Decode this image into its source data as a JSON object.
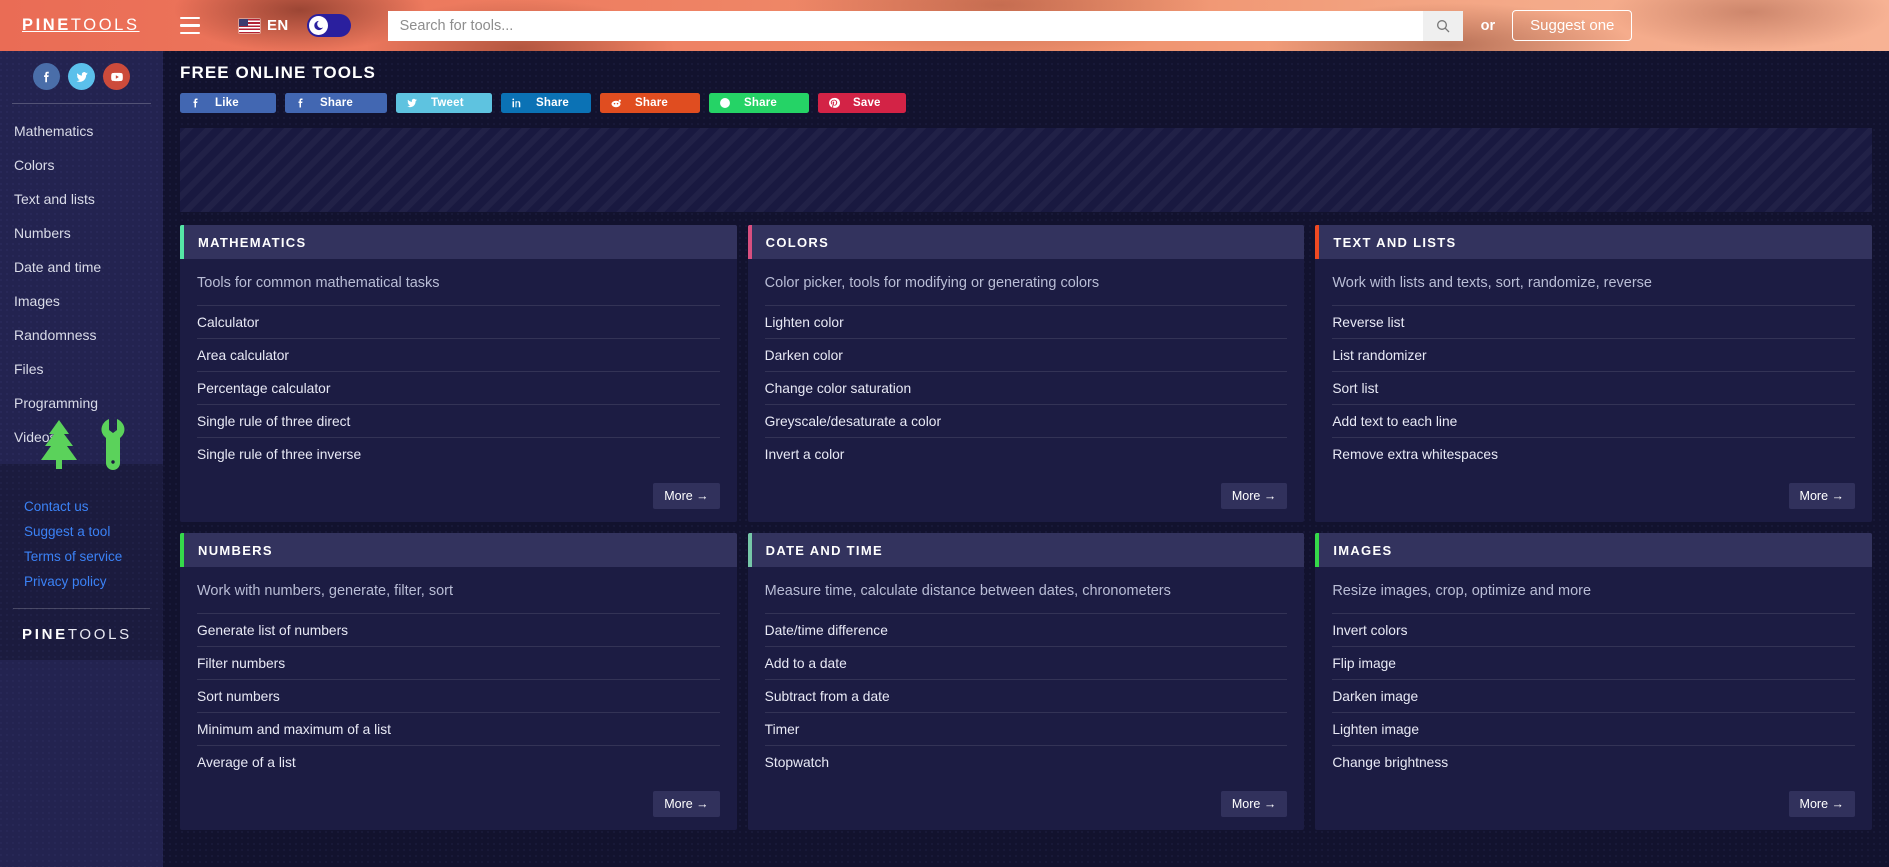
{
  "topbar": {
    "logo_bold": "PINE",
    "logo_light": "TOOLS",
    "menu_icon": "hamburger-icon",
    "language": "EN",
    "flag_icon": "us-flag-icon",
    "darkmode_icon": "moon-icon",
    "search_placeholder": "Search for tools...",
    "search_value": "",
    "search_icon": "magnifier-icon",
    "or_label": "or",
    "suggest_label": "Suggest one"
  },
  "sidebar": {
    "social": [
      {
        "name": "facebook",
        "icon": "facebook-icon",
        "color": "#4a6ea9"
      },
      {
        "name": "twitter",
        "icon": "twitter-icon",
        "color": "#5bc0eb"
      },
      {
        "name": "youtube",
        "icon": "youtube-icon",
        "color": "#cc4b3b"
      }
    ],
    "nav": [
      "Mathematics",
      "Colors",
      "Text and lists",
      "Numbers",
      "Date and time",
      "Images",
      "Randomness",
      "Files",
      "Programming",
      "Videos"
    ],
    "brand_icons": [
      {
        "icon": "pine-tree-icon",
        "color": "#5bd25b"
      },
      {
        "icon": "wrench-icon",
        "color": "#5bd25b"
      }
    ],
    "footer_links": [
      "Contact us",
      "Suggest a tool",
      "Terms of service",
      "Privacy policy"
    ],
    "footer_logo_bold": "PINE",
    "footer_logo_light": "TOOLS"
  },
  "main": {
    "page_title": "FREE ONLINE TOOLS",
    "share_buttons": [
      {
        "label": "Like",
        "icon": "facebook-icon",
        "class": "sb-facebook-like",
        "color": "#4267b2"
      },
      {
        "label": "Share",
        "icon": "facebook-icon",
        "class": "sb-facebook-share",
        "color": "#4267b2"
      },
      {
        "label": "Tweet",
        "icon": "twitter-icon",
        "class": "sb-twitter",
        "color": "#5ec3e0"
      },
      {
        "label": "Share",
        "icon": "linkedin-icon",
        "class": "sb-linkedin",
        "color": "#0b72b5"
      },
      {
        "label": "Share",
        "icon": "reddit-icon",
        "class": "sb-reddit",
        "color": "#e04d20"
      },
      {
        "label": "Share",
        "icon": "whatsapp-icon",
        "class": "sb-whatsapp",
        "color": "#25d366"
      },
      {
        "label": "Save",
        "icon": "pinterest-icon",
        "class": "sb-pinterest",
        "color": "#d32346"
      }
    ],
    "more_label": "More →",
    "cards": [
      {
        "title": "MATHEMATICS",
        "accent": "#55e6a5",
        "description": "Tools for common mathematical tasks",
        "links": [
          "Calculator",
          "Area calculator",
          "Percentage calculator",
          "Single rule of three direct",
          "Single rule of three inverse"
        ]
      },
      {
        "title": "COLORS",
        "accent": "#d94f7f",
        "description": "Color picker, tools for modifying or generating colors",
        "links": [
          "Lighten color",
          "Darken color",
          "Change color saturation",
          "Greyscale/desaturate a color",
          "Invert a color"
        ]
      },
      {
        "title": "TEXT AND LISTS",
        "accent": "#f04a22",
        "description": "Work with lists and texts, sort, randomize, reverse",
        "links": [
          "Reverse list",
          "List randomizer",
          "Sort list",
          "Add text to each line",
          "Remove extra whitespaces"
        ]
      },
      {
        "title": "NUMBERS",
        "accent": "#35d94a",
        "description": "Work with numbers, generate, filter, sort",
        "links": [
          "Generate list of numbers",
          "Filter numbers",
          "Sort numbers",
          "Minimum and maximum of a list",
          "Average of a list"
        ]
      },
      {
        "title": "DATE AND TIME",
        "accent": "#76c7a8",
        "description": "Measure time, calculate distance between dates, chronometers",
        "links": [
          "Date/time difference",
          "Add to a date",
          "Subtract from a date",
          "Timer",
          "Stopwatch"
        ]
      },
      {
        "title": "IMAGES",
        "accent": "#35d94a",
        "description": "Resize images, crop, optimize and more",
        "links": [
          "Invert colors",
          "Flip image",
          "Darken image",
          "Lighten image",
          "Change brightness"
        ]
      }
    ]
  }
}
